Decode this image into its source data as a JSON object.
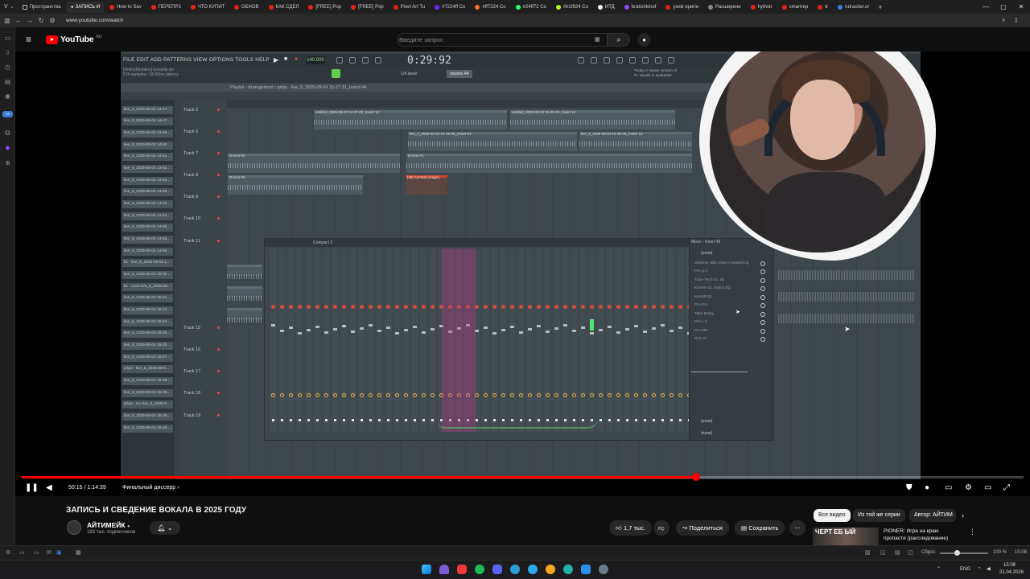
{
  "browser": {
    "tabs": [
      {
        "label": "Пространства",
        "active": false
      },
      {
        "label": "ЗАПИСЬ И",
        "active": true
      },
      {
        "label": "How to Sav",
        "active": false
      },
      {
        "label": "ПЕРЕПРЗ",
        "active": false
      },
      {
        "label": "ЧТО КУПИТ",
        "active": false
      },
      {
        "label": "ОБНОВ",
        "active": false
      },
      {
        "label": "КАК СДЕЛ",
        "active": false
      },
      {
        "label": "[FREE] Pop",
        "active": false
      },
      {
        "label": "[FREE] Pop",
        "active": false
      },
      {
        "label": "Pixel Art Tu",
        "active": false
      },
      {
        "label": "#7224ff Co",
        "active": false
      },
      {
        "label": "#ff7224 Co",
        "active": false
      },
      {
        "label": "#24ff72 Co",
        "active": false
      },
      {
        "label": "#b1f824 Co",
        "active": false
      },
      {
        "label": "ИТД",
        "active": false
      },
      {
        "label": "bratishkinof",
        "active": false
      },
      {
        "label": "узнік оригін",
        "active": false
      },
      {
        "label": "Расширени",
        "active": false
      },
      {
        "label": "hythstr",
        "active": false
      },
      {
        "label": "smartrep",
        "active": false
      },
      {
        "label": "tr",
        "active": false
      },
      {
        "label": "rutracker.or",
        "active": false
      }
    ],
    "url": "www.youtube.com/watch"
  },
  "youtube": {
    "logo_text": "YouTube",
    "logo_region": "RU",
    "search_placeholder": "Введите запрос"
  },
  "fl": {
    "menu": "FILE  EDIT  ADD  PATTERNS  VIEW  OPTIONS  TOOLS  HELP",
    "info_line1": "[DmitryMolokov] kozablik.zip",
    "info_line2": "574 samples / 18.02ms latency",
    "bpm": "140.000",
    "time": "0:29:92",
    "snap": "1/6 beat",
    "drums": "drums #4",
    "news_line1": "Today  A newer version of",
    "news_line2": "FL Studio is available!",
    "playlist_title": "Playlist - Arrangement › pripa - live_5_2025-08-04 15-27-31_Insert 44",
    "browser_items": [
      "live_5_2025-08-04 14-47-...",
      "live_5_2025-08-04 14-47...",
      "live_5_2025-08-04 14-48...",
      "live_5_2025-08-04 14-50...",
      "live_5_2025-08-04 14-51...",
      "live_5_2025-08-04 14-52...",
      "live_5_2025-08-04 14-52...",
      "live_5_2025-08-04 14-53...",
      "live_5_2025-08-04 14-53...",
      "live_5_2025-08-04 14-54...",
      "live_5_2025-08-04 14-55...",
      "live_5_2025-08-04 14-55...",
      "live_5_2025-08-04 14-56...",
      "k1 - live_5_2025-08-04 1...",
      "live_5_2025-08-04 15-00...",
      "k1 - novo live_5_2025-08...",
      "live_5_2025-08-04 15-21...",
      "live_5_2025-08-04 15-24...",
      "live_5_2025-08-04 15-24...",
      "live_5_2025-08-04 15-25...",
      "live_5_2025-08-04 15-25...",
      "live_5_2025-08-04 15-27...",
      "pripa - live_5_2025-08-0...",
      "live_5_2025-08-04 15-28...",
      "live_5_2025-08-04 15-28...",
      "pripa - rov live_5_2025-0...",
      "live_5_2025-08-04 15-28...",
      "live_5_2025-08-04 15-28..."
    ],
    "tracks": [
      "Track 5",
      "Track 6",
      "Track 7",
      "Track 8",
      "Track 9",
      "Track 10",
      "Track 11",
      "Track 15",
      "Track 16",
      "Track 17",
      "Track 18",
      "Track 19"
    ],
    "clips": {
      "c1": "untitled_2025-08-04 14-47-00_Insert 14",
      "c2": "untitled_2025-08-04 15-40-00_Insert 14",
      "c3": "live_4_2025-08-04 12-45-46_Insert 13",
      "c4": "live_4_2025-08-04 12-45-46_Insert 13",
      "c5": "Drums #2",
      "c6": "Drums #1",
      "c7": "Drums #6",
      "cymbal": "[48] Cymbal (magic)"
    },
    "mixer_title": "Compact 2",
    "mixer_right_title": "Mixer - Insert 48",
    "mixer_none": "(none)",
    "fx_slots": [
      "Shadow Hills Class A Mastering",
      "Pro-Q 4",
      "Tube-Tech CL 1B",
      "Kramer EL Match EQ",
      "smartEQ4",
      "Pro-DS",
      "Tape Delay",
      "Pro-L 2",
      "Pro-MB",
      "Slot 10"
    ],
    "mixer_none_bottom_1": "(none)",
    "mixer_none_bottom_2": "(none)"
  },
  "player": {
    "current_time": "50:15",
    "duration": "1:14:39",
    "timecode_text": "50:15 / 1:14:39",
    "chapter": "Финальный диссерр",
    "progress_percent": 67.3
  },
  "video": {
    "title": "ЗАПИСЬ И СВЕДЕНИЕ ВОКАЛА В 2025 ГОДУ",
    "channel_name": "АЙТИМЕЙК",
    "subscribers": "183 тыс. подписчиков",
    "likes": "1,7 тыс.",
    "share_label": "Поделиться",
    "save_label": "Сохранить"
  },
  "recommendations": {
    "chips": [
      "Все видео",
      "Из той же серии",
      "Автор: АЙТИМ"
    ],
    "selected_chip": "Все видео",
    "item_title_line1": "PIONER: Игра на краю",
    "item_title_line2": "пропасти (расследование)",
    "item_thumb_text": "ЧЕРТ ЕБ   ЫЙ"
  },
  "statusbar": {
    "reset_label": "Сброс",
    "zoom": "100 %",
    "time": "15:08"
  },
  "taskbar": {
    "lang": "ENG",
    "time": "15:08",
    "date": "21.04.2026"
  },
  "colors": {
    "yt_red": "#ff0000",
    "fl_bg": "#3a4247",
    "accent_pink": "#be3c8c",
    "vu_green": "#4fe36f"
  }
}
